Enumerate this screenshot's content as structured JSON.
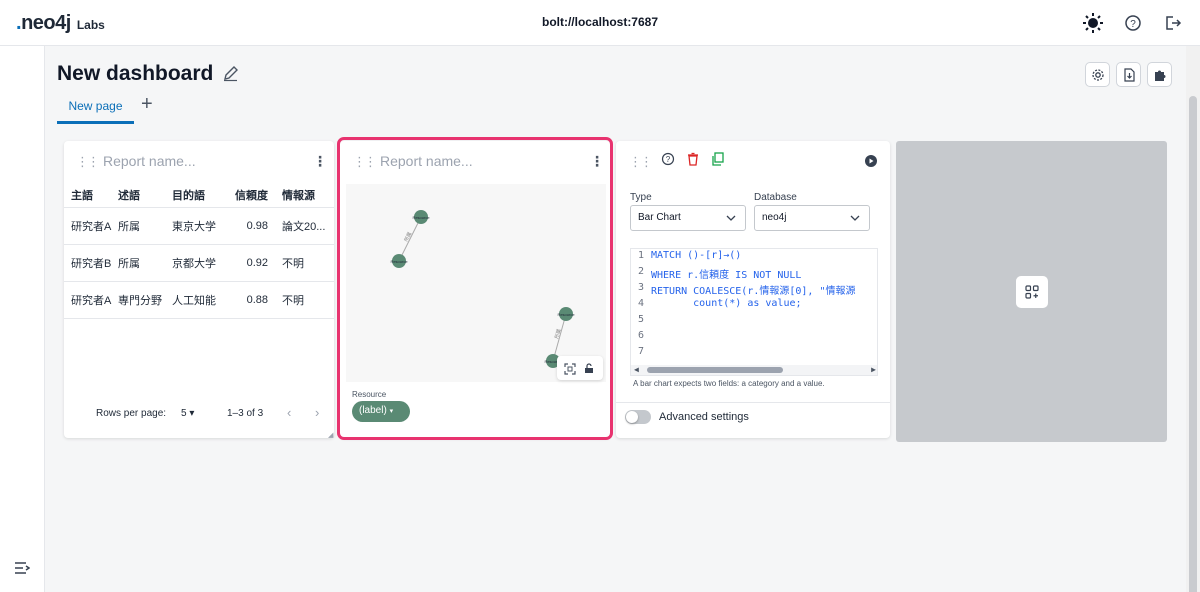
{
  "app": {
    "logo": "neo4j",
    "logo_suffix": "Labs",
    "connection": "bolt://localhost:7687"
  },
  "icons": {
    "theme": "sun-icon",
    "help": "help-icon",
    "logout": "logout-icon",
    "sidebar_toggle": "sidebar-expand-icon"
  },
  "dashboard": {
    "title": "New dashboard"
  },
  "tabs": [
    {
      "label": "New page",
      "active": true
    }
  ],
  "toolbar": {
    "tab_add": "+"
  },
  "report_table": {
    "placeholder": "Report name...",
    "headers": [
      "主語",
      "述語",
      "目的語",
      "信頼度",
      "情報源"
    ],
    "rows": [
      [
        "研究者A",
        "所属",
        "東京大学",
        "0.98",
        "論文20..."
      ],
      [
        "研究者B",
        "所属",
        "京都大学",
        "0.92",
        "不明"
      ],
      [
        "研究者A",
        "専門分野",
        "人工知能",
        "0.88",
        "不明"
      ]
    ],
    "pager": {
      "rows_label": "Rows per page:",
      "rows_value": "5",
      "range": "1–3 of 3"
    }
  },
  "report_graph": {
    "placeholder": "Report name...",
    "nodes": [
      {
        "label": "Resource"
      },
      {
        "label": "Resource"
      },
      {
        "label": "Resource"
      },
      {
        "label": "Resource"
      }
    ],
    "edge_label": "所属",
    "legend_label": "Resource",
    "chip_label": "(label)"
  },
  "editor": {
    "type_label": "Type",
    "type_value": "Bar Chart",
    "database_label": "Database",
    "database_value": "neo4j",
    "code_lines": [
      {
        "n": "1",
        "text": "MATCH ()-[r]→()"
      },
      {
        "n": "2",
        "text": "WHERE r.信頼度 IS NOT NULL"
      },
      {
        "n": "3",
        "text": "RETURN COALESCE(r.情報源[0], \"情報源"
      },
      {
        "n": "4",
        "text": "       count(*) as value;"
      },
      {
        "n": "5",
        "text": ""
      },
      {
        "n": "6",
        "text": ""
      },
      {
        "n": "7",
        "text": ""
      }
    ],
    "hint": "A bar chart expects two fields: a category and a value.",
    "advanced_label": "Advanced settings"
  }
}
